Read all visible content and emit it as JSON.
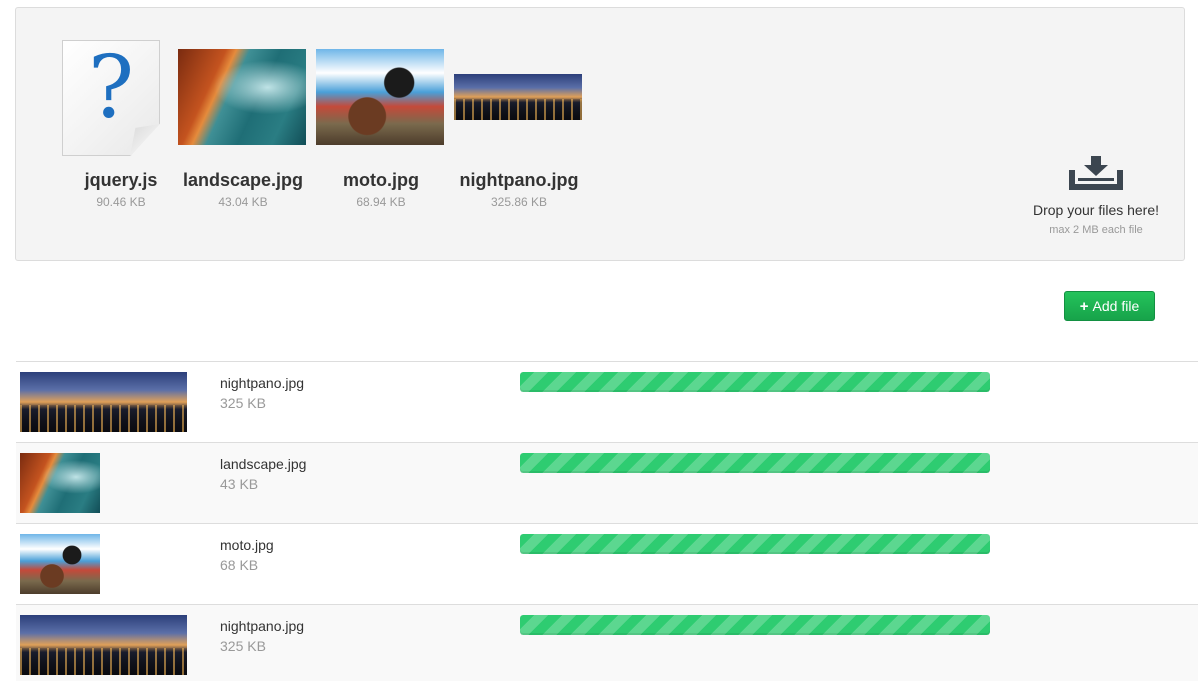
{
  "colors": {
    "accent": "#1ebd55",
    "progress": "#2ecc71",
    "dropzone_bg": "#f4f4f4",
    "doc_icon_glyph": "#1e6fc0"
  },
  "dropzone": {
    "files": [
      {
        "name": "jquery.js",
        "size": "90.46 KB",
        "preview": "document-question-icon"
      },
      {
        "name": "landscape.jpg",
        "size": "43.04 KB",
        "preview": "landscape"
      },
      {
        "name": "moto.jpg",
        "size": "68.94 KB",
        "preview": "moto"
      },
      {
        "name": "nightpano.jpg",
        "size": "325.86 KB",
        "preview": "nightpano"
      }
    ],
    "hint": {
      "icon": "download-tray-icon",
      "title": "Drop your files here!",
      "subtitle": "max 2 MB each file"
    },
    "doc_glyph": "?"
  },
  "toolbar": {
    "add_icon": "+",
    "add_label": "Add file"
  },
  "uploads": [
    {
      "name": "nightpano.jpg",
      "size": "325 KB",
      "preview": "nightpano",
      "progress": 1.0
    },
    {
      "name": "landscape.jpg",
      "size": "43 KB",
      "preview": "landscape",
      "progress": 1.0
    },
    {
      "name": "moto.jpg",
      "size": "68 KB",
      "preview": "moto",
      "progress": 1.0
    },
    {
      "name": "nightpano.jpg",
      "size": "325 KB",
      "preview": "nightpano",
      "progress": 1.0
    }
  ]
}
